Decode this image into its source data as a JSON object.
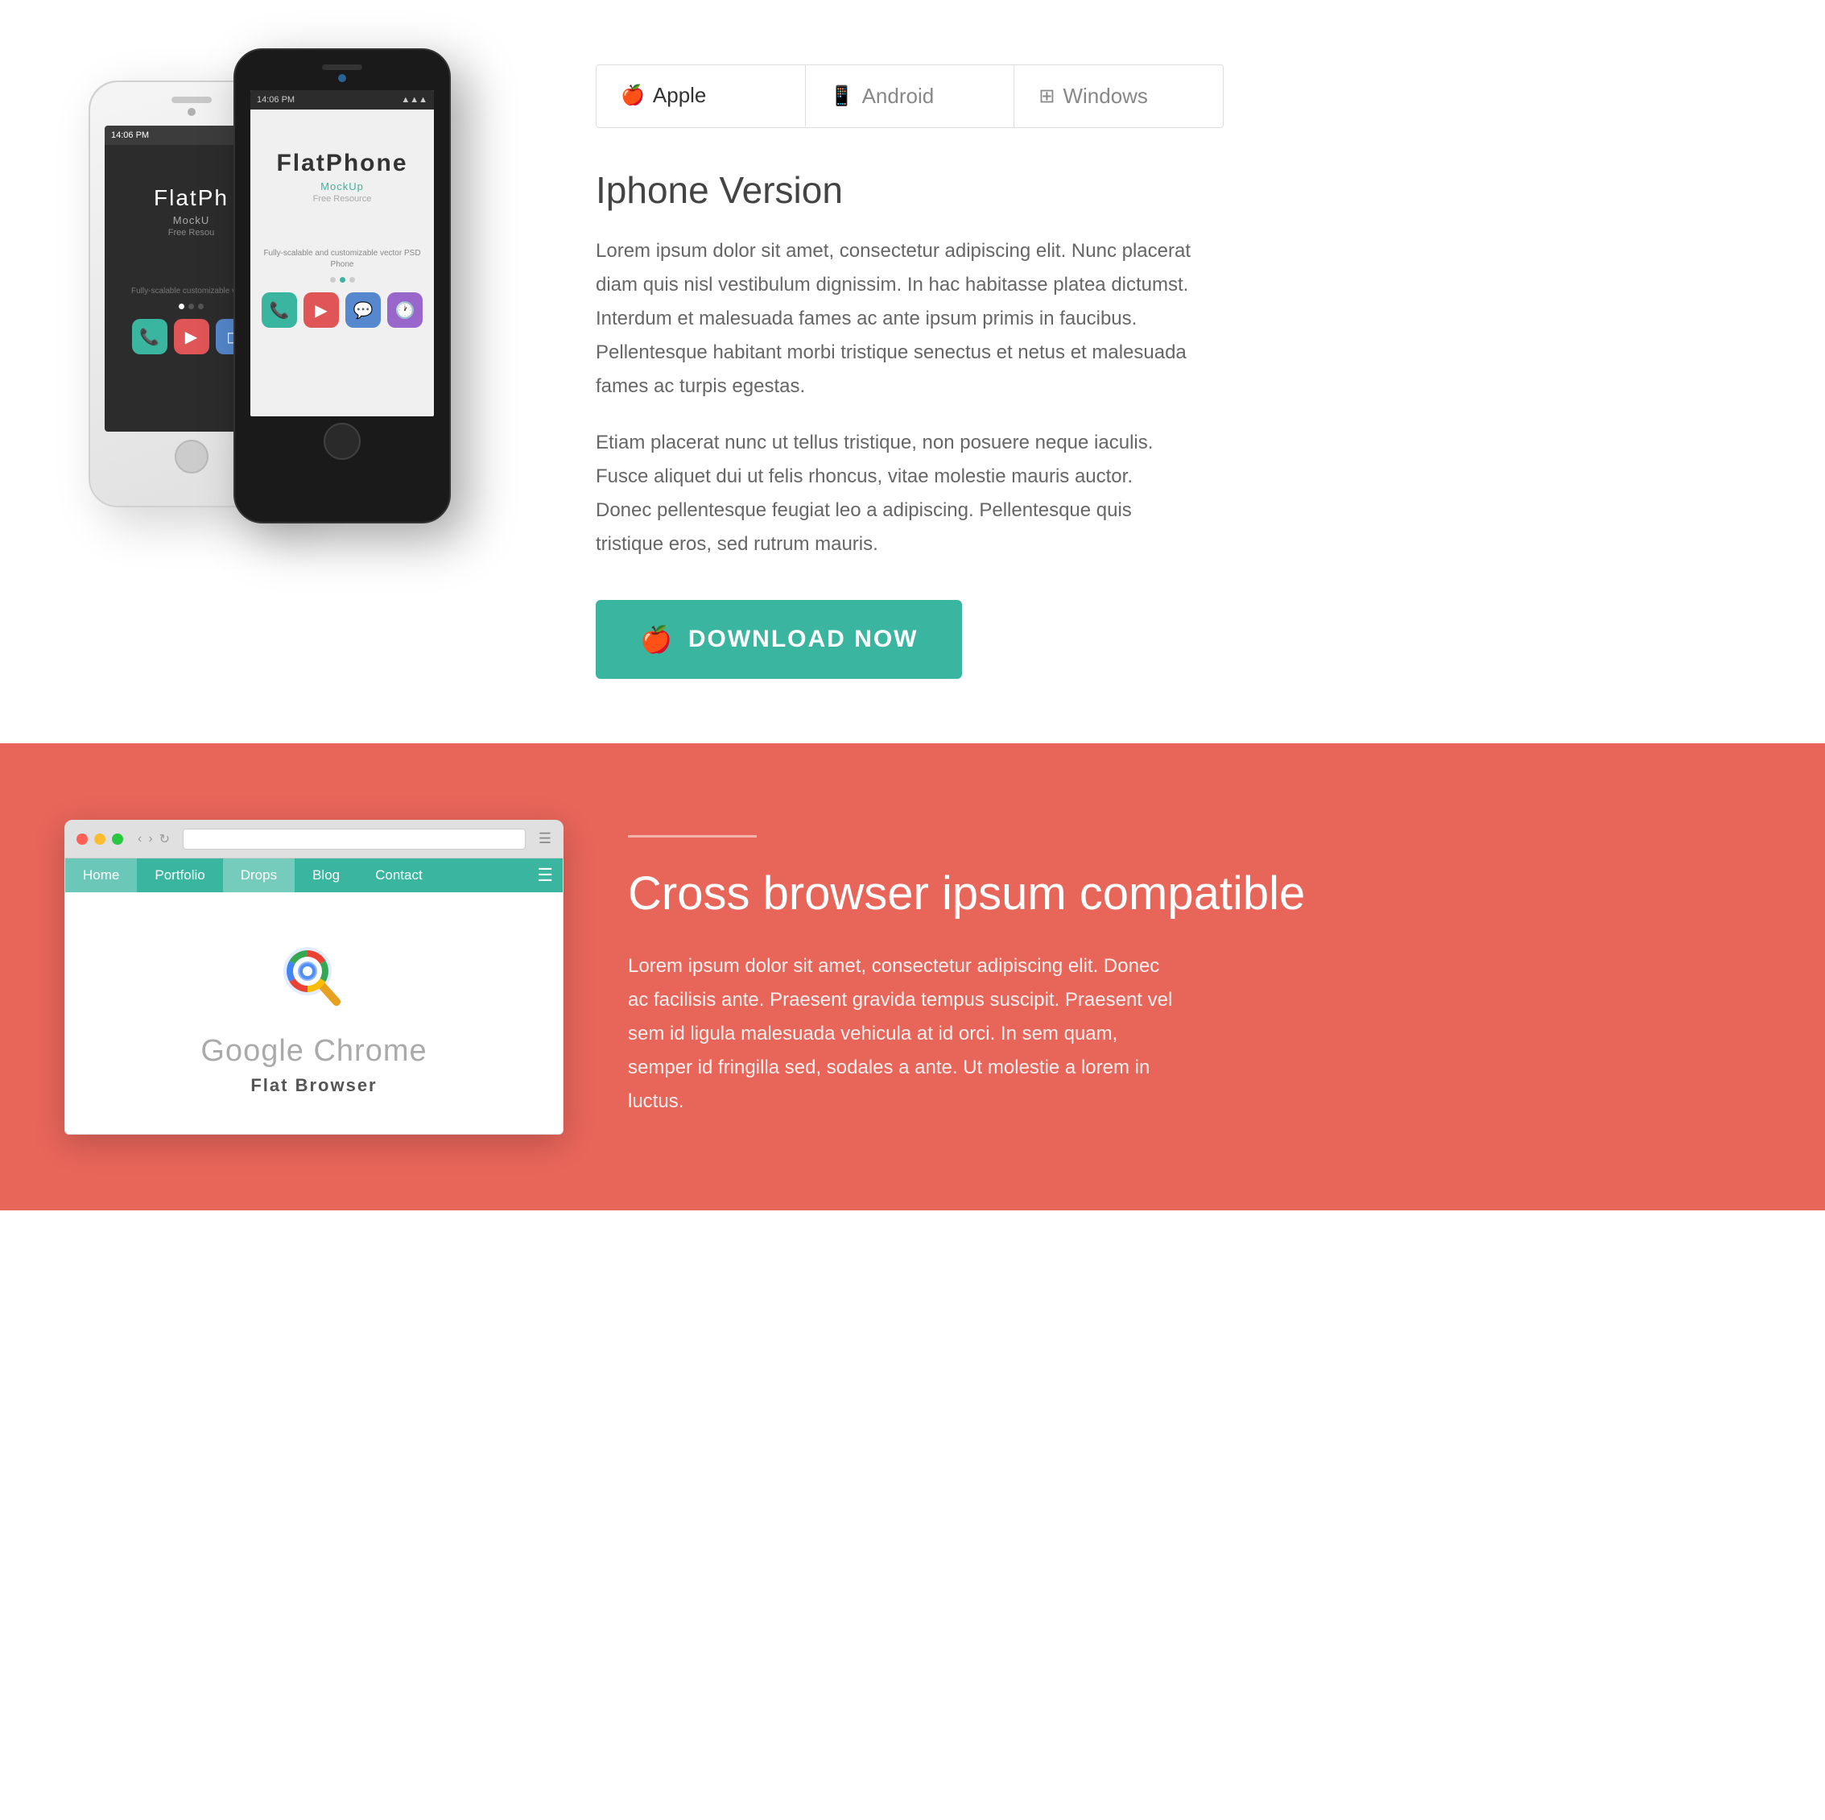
{
  "tabs": {
    "items": [
      {
        "id": "apple",
        "label": "Apple",
        "icon": "🍎",
        "active": true
      },
      {
        "id": "android",
        "label": "Android",
        "icon": "📱",
        "active": false
      },
      {
        "id": "windows",
        "label": "Windows",
        "icon": "⊞",
        "active": false
      }
    ]
  },
  "iphone_section": {
    "title": "Iphone Version",
    "para1": "Lorem ipsum dolor sit amet, consectetur adipiscing elit. Nunc placerat diam quis nisl vestibulum dignissim. In hac habitasse platea dictumst. Interdum et malesuada fames ac ante ipsum primis in faucibus. Pellentesque habitant morbi tristique senectus et netus et malesuada fames ac turpis egestas.",
    "para2": "Etiam placerat nunc ut tellus tristique, non posuere neque iaculis. Fusce aliquet dui ut felis rhoncus, vitae molestie mauris auctor. Donec pellentesque feugiat leo a adipiscing. Pellentesque quis tristique eros, sed rutrum mauris.",
    "download_label": "DOWNLOAD NOW"
  },
  "phone_white": {
    "time": "14:06 PM",
    "app_name_1": "FlatPh",
    "app_name_2": "MockU",
    "app_sub": "Free Resou",
    "description": "Fully-scalable customizable vecto"
  },
  "phone_black": {
    "time": "14:06 PM",
    "app_name": "FlatPhone",
    "app_bold": "Phone",
    "app_name_plain": "Flat",
    "app_sub": "MockUp",
    "app_free": "Free Resource",
    "description": "Fully-scalable and customizable vector PSD Phone"
  },
  "cross_browser": {
    "title": "Cross browser ipsum compatible",
    "para": "Lorem ipsum dolor sit amet, consectetur adipiscing elit. Donec ac facilisis ante. Praesent gravida tempus suscipit. Praesent vel sem id ligula malesuada vehicula at id orci. In sem quam, semper id fringilla sed, sodales a ante. Ut molestie a lorem in luctus.",
    "divider": true
  },
  "browser_mockup": {
    "nav_items": [
      "Home",
      "Portfolio",
      "Drops",
      "Blog",
      "Contact"
    ],
    "active_nav": "Drops",
    "app_name": "Google Chrome",
    "app_sub": "Flat Browser"
  },
  "colors": {
    "teal": "#3ab5a0",
    "coral": "#e8655a",
    "dark_text": "#444",
    "light_text": "#666"
  }
}
